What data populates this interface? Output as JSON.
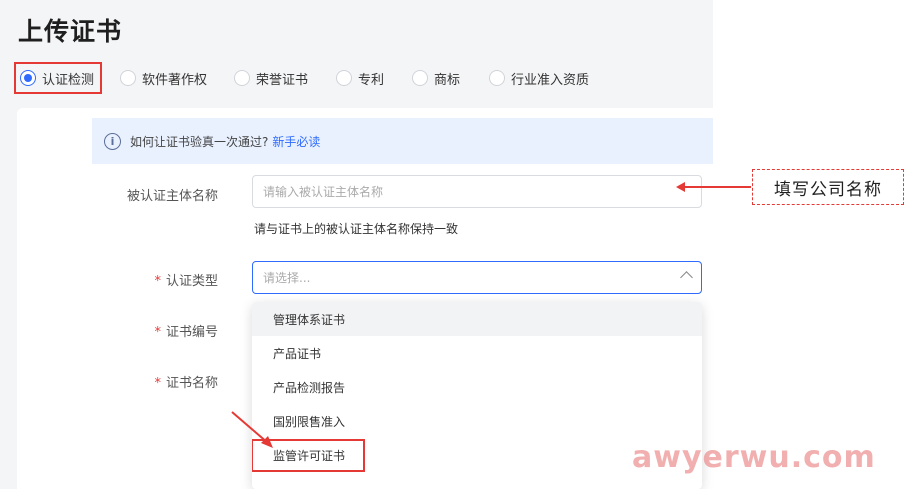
{
  "page": {
    "title": "上传证书"
  },
  "tabs": [
    {
      "label": "认证检测",
      "selected": true
    },
    {
      "label": "软件著作权",
      "selected": false
    },
    {
      "label": "荣誉证书",
      "selected": false
    },
    {
      "label": "专利",
      "selected": false
    },
    {
      "label": "商标",
      "selected": false
    },
    {
      "label": "行业准入资质",
      "selected": false
    }
  ],
  "info": {
    "text": "如何让证书验真一次通过?",
    "link": "新手必读",
    "icon": "info-icon"
  },
  "form": {
    "subject": {
      "label": "被认证主体名称",
      "placeholder": "请输入被认证主体名称",
      "hint": "请与证书上的被认证主体名称保持一致"
    },
    "type": {
      "required_mark": "*",
      "label": "认证类型",
      "placeholder": "请选择..."
    },
    "number": {
      "required_mark": "*",
      "label": "证书编号"
    },
    "name": {
      "required_mark": "*",
      "label": "证书名称"
    }
  },
  "dropdown": {
    "options": [
      "管理体系证书",
      "产品证书",
      "产品检测报告",
      "国别限售准入",
      "监管许可证书"
    ]
  },
  "annotation": {
    "callout": "填写公司名称"
  },
  "watermark": "awyerwu.com",
  "colors": {
    "accent": "#2f6bff",
    "highlight": "#e53935",
    "info_bg": "#e9f1ff"
  }
}
